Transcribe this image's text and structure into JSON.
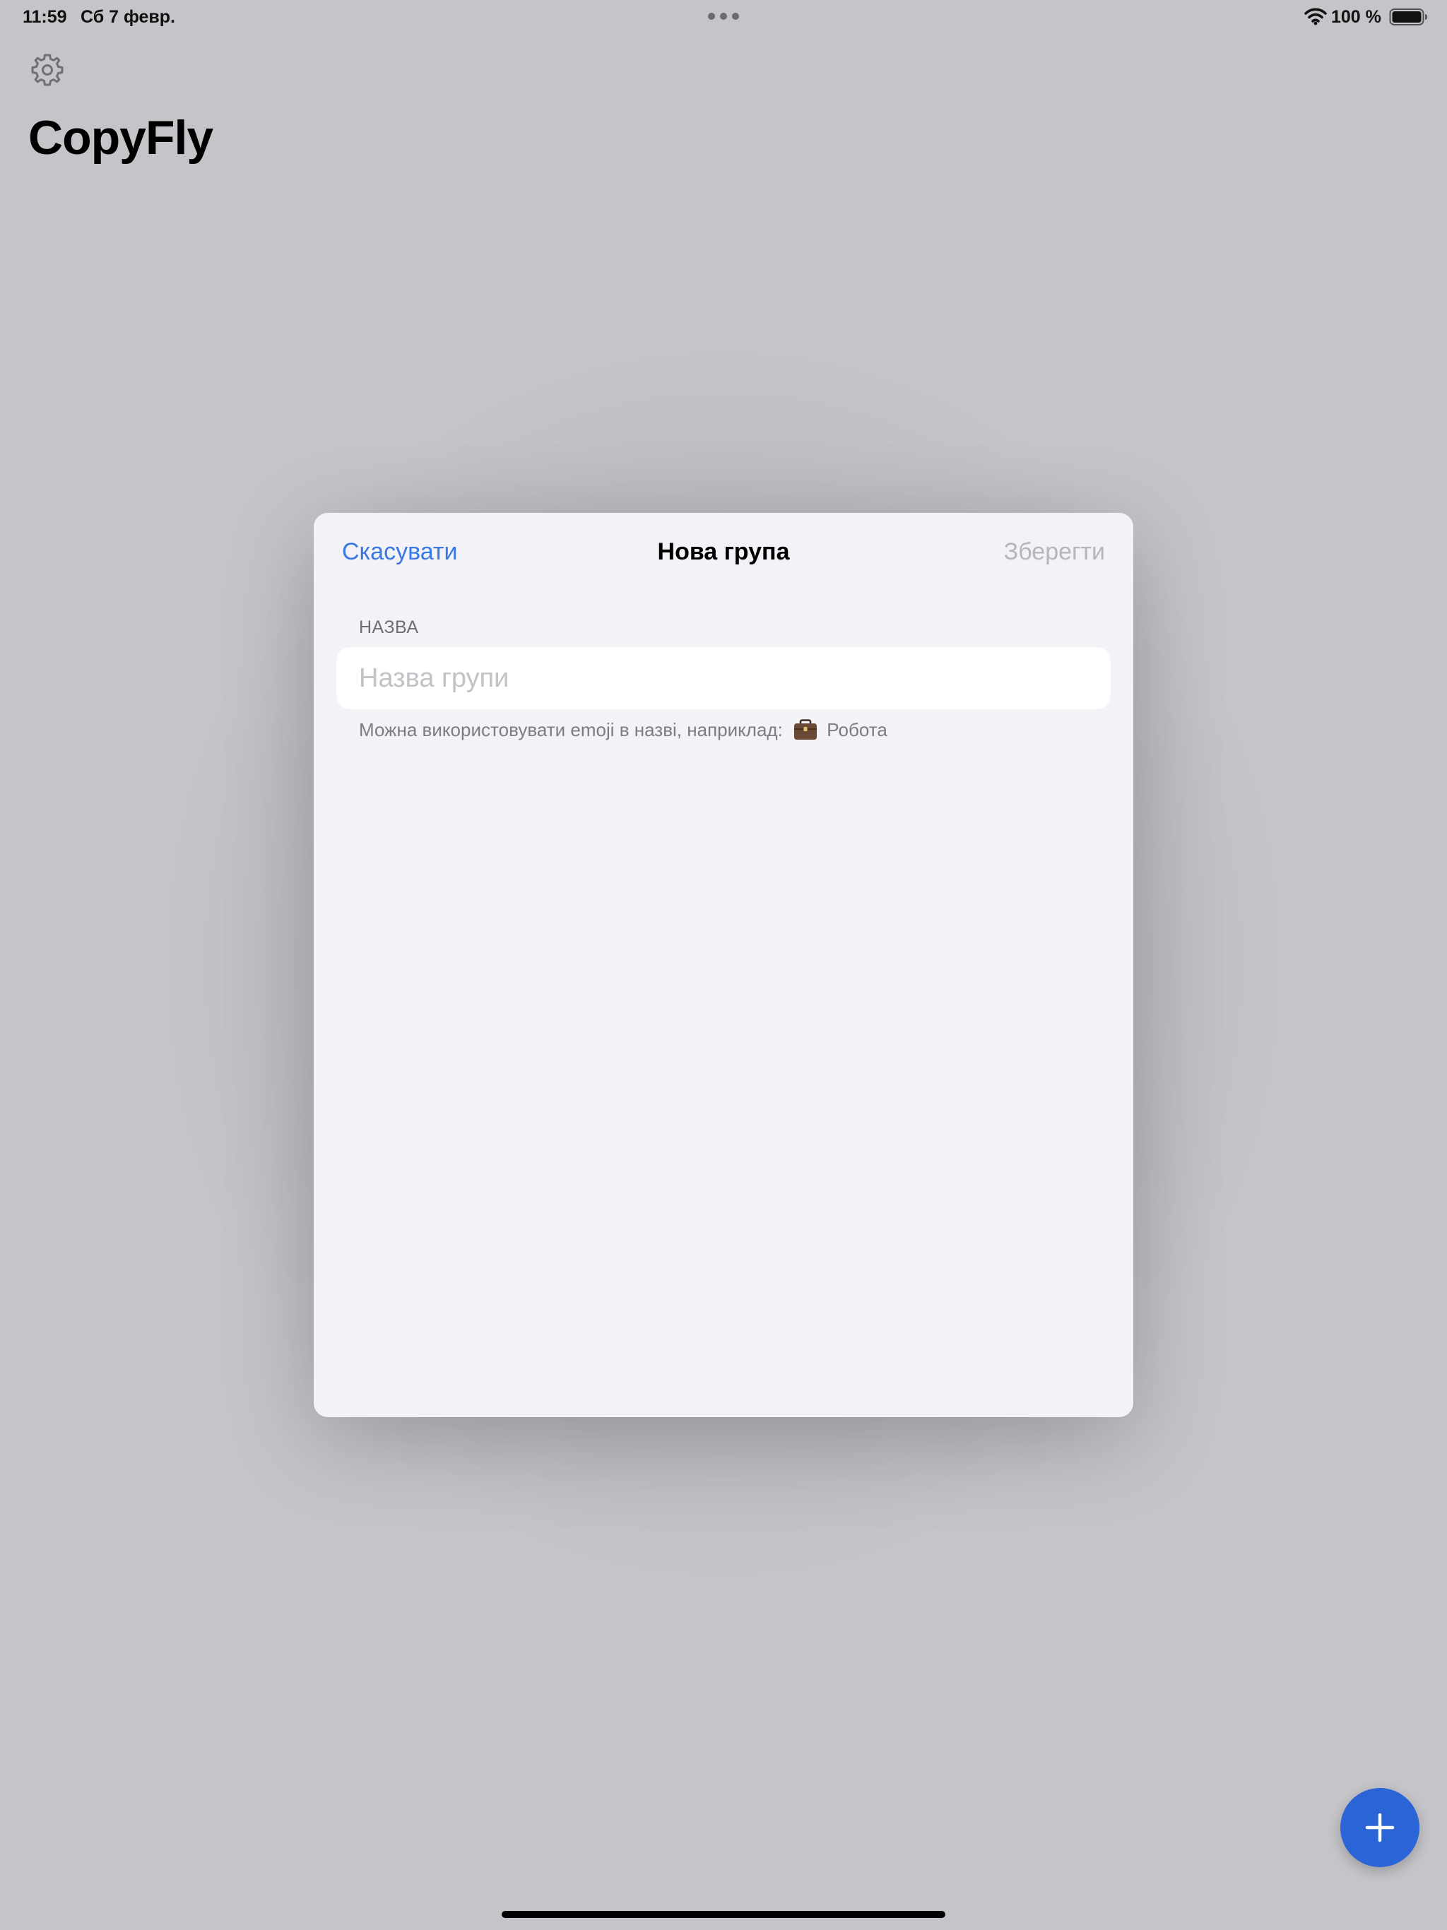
{
  "status_bar": {
    "time": "11:59",
    "date": "Сб 7 февр.",
    "battery_percent": "100 %",
    "battery_level": 1.0,
    "icons": [
      "wifi-icon",
      "battery-icon"
    ]
  },
  "app": {
    "title": "CopyFly",
    "settings_icon": "gear-icon",
    "fab_icon": "plus-icon",
    "accent_color": "#2a64d6"
  },
  "modal": {
    "cancel_label": "Скасувати",
    "title": "Нова група",
    "save_label": "Зберегти",
    "section_header": "НАЗВА",
    "name_field": {
      "value": "",
      "placeholder": "Назва групи"
    },
    "footer_text": "Можна використовувати emoji в назві, наприклад:",
    "footer_example_icon": "briefcase-icon",
    "footer_example_text": "Робота",
    "link_color": "#3a78e6",
    "disabled_color": "#b5b5ba"
  }
}
